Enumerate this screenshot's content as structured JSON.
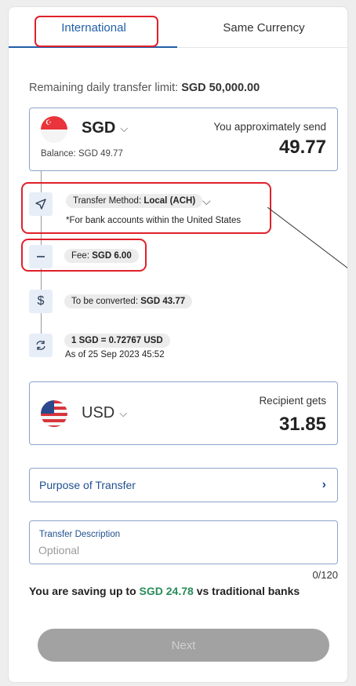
{
  "tabs": [
    {
      "label": "International",
      "active": true
    },
    {
      "label": "Same Currency",
      "active": false
    }
  ],
  "limit": {
    "label": "Remaining daily transfer limit:",
    "value": "SGD 50,000.00"
  },
  "send": {
    "currency": "SGD",
    "balance": "Balance: SGD 49.77",
    "amount_label": "You approximately send",
    "amount": "49.77"
  },
  "steps": {
    "method_label": "Transfer Method:",
    "method_value": "Local (ACH)",
    "method_note": "*For bank accounts within the United States",
    "fee_label": "Fee:",
    "fee_value": "SGD 6.00",
    "convert_label": "To be converted:",
    "convert_value": "SGD 43.77",
    "rate": "1 SGD = 0.72767 USD",
    "rate_date": "As of 25 Sep 2023 45:52"
  },
  "receive": {
    "currency": "USD",
    "amount_label": "Recipient gets",
    "amount": "31.85"
  },
  "purpose": {
    "label": "Purpose of Transfer"
  },
  "description": {
    "label": "Transfer Description",
    "placeholder": "Optional",
    "counter": "0/120"
  },
  "saving": {
    "prefix": "You are saving up to",
    "amount": "SGD 24.78",
    "suffix": "vs traditional banks"
  },
  "next_button": {
    "label": "Next"
  },
  "colors": {
    "accent": "#1f5fa8",
    "highlight": "#e0202a",
    "saving_green": "#2a8c5a",
    "button_disabled": "#a2a2a2"
  },
  "icons": {
    "method": "send-arrow-icon",
    "fee": "minus-icon",
    "convert": "dollar-icon",
    "rate": "refresh-icon"
  }
}
